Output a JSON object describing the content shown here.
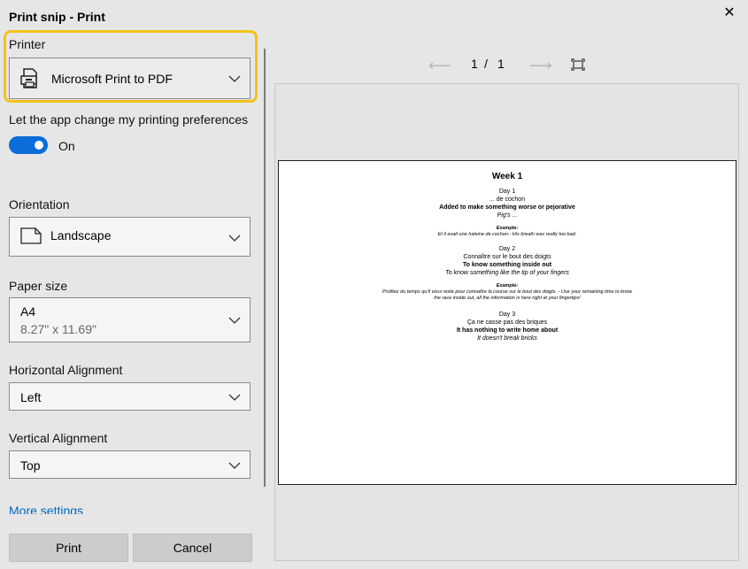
{
  "window": {
    "title": "Print snip - Print"
  },
  "printer": {
    "label": "Printer",
    "selected": "Microsoft Print to PDF"
  },
  "preferences": {
    "label": "Let the app change my printing preferences",
    "toggle_state": "On"
  },
  "orientation": {
    "label": "Orientation",
    "selected": "Landscape"
  },
  "paper_size": {
    "label": "Paper size",
    "selected": "A4",
    "dimensions": "8.27\" x 11.69\""
  },
  "horizontal_alignment": {
    "label": "Horizontal Alignment",
    "selected": "Left"
  },
  "vertical_alignment": {
    "label": "Vertical Alignment",
    "selected": "Top"
  },
  "more_settings": "More settings",
  "buttons": {
    "print": "Print",
    "cancel": "Cancel"
  },
  "pager": {
    "current": "1",
    "separator": "/",
    "total": "1"
  },
  "preview": {
    "heading": "Week 1",
    "day1": {
      "title": "Day 1",
      "phrase": "... de cochon",
      "meaning": "Added to make something worse or pejorative",
      "literal": "Pig's ...",
      "example_label": "Example:",
      "example": "Et il avait une haleine de cochon.- His breath was really too bad."
    },
    "day2": {
      "title": "Day 2",
      "phrase": "Connaître sur le bout des doigts",
      "meaning": "To know something inside out",
      "literal": "To know something like the tip of your fingers",
      "example_label": "Example:",
      "example_line1": "Profitez du temps qu'il vous reste pour connaître la course sur le bout des doigts. - Use your remaining time to know",
      "example_line2": "the race inside out, all the information is here right at your fingertips!"
    },
    "day3": {
      "title": "Day 3",
      "phrase": "Ça ne casse pas des briques",
      "meaning": "It has nothing to write home about",
      "literal": "It doesn't break bricks"
    }
  }
}
